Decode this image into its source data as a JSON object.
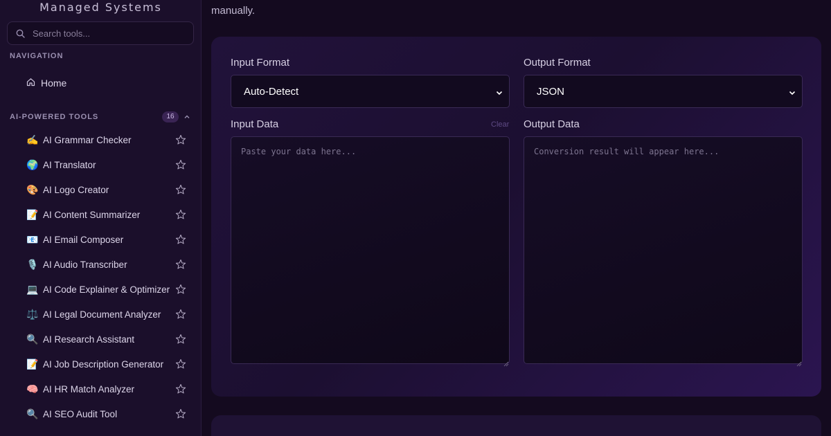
{
  "sidebar": {
    "brand": "Managed Systems",
    "search": {
      "placeholder": "Search tools..."
    },
    "navigation_label": "NAVIGATION",
    "home_label": "Home",
    "ai_tools_label": "AI-POWERED TOOLS",
    "ai_tools_count": "16",
    "tools": [
      {
        "emoji": "✍️",
        "label": "AI Grammar Checker"
      },
      {
        "emoji": "🌍",
        "label": "AI Translator"
      },
      {
        "emoji": "🎨",
        "label": "AI Logo Creator"
      },
      {
        "emoji": "📝",
        "label": "AI Content Summarizer"
      },
      {
        "emoji": "📧",
        "label": "AI Email Composer"
      },
      {
        "emoji": "🎙️",
        "label": "AI Audio Transcriber"
      },
      {
        "emoji": "💻",
        "label": "AI Code Explainer & Optimizer"
      },
      {
        "emoji": "⚖️",
        "label": "AI Legal Document Analyzer"
      },
      {
        "emoji": "🔍",
        "label": "AI Research Assistant"
      },
      {
        "emoji": "📝",
        "label": "AI Job Description Generator"
      },
      {
        "emoji": "🧠",
        "label": "AI HR Match Analyzer"
      },
      {
        "emoji": "🔍",
        "label": "AI SEO Audit Tool"
      }
    ]
  },
  "main": {
    "intro_end": "manually.",
    "input_format_label": "Input Format",
    "input_format_value": "Auto-Detect",
    "output_format_label": "Output Format",
    "output_format_value": "JSON",
    "input_data_label": "Input Data",
    "clear_label": "Clear",
    "input_placeholder": "Paste your data here...",
    "output_data_label": "Output Data",
    "output_placeholder": "Conversion result will appear here..."
  },
  "colors": {
    "accent": "#7b45d6",
    "background": "#140a1f",
    "sidebar": "#1b0f2b"
  }
}
